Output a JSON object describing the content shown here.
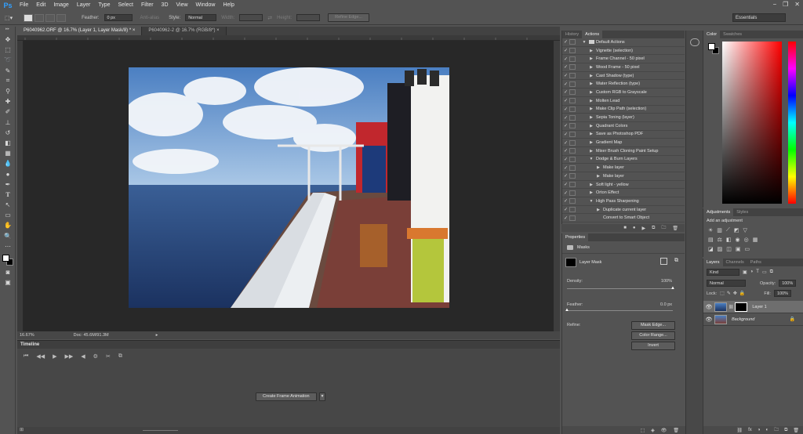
{
  "app": {
    "logo": "Ps"
  },
  "menu": [
    "File",
    "Edit",
    "Image",
    "Layer",
    "Type",
    "Select",
    "Filter",
    "3D",
    "View",
    "Window",
    "Help"
  ],
  "window_controls": [
    "−",
    "❐",
    "✕"
  ],
  "options": {
    "feather_label": "Feather:",
    "feather_value": "0 px",
    "antialias_label": "Anti-alias",
    "style_label": "Style:",
    "style_value": "Normal",
    "width_label": "Width:",
    "height_label": "Height:",
    "refine_edge": "Refine Edge...",
    "workspace": "Essentials"
  },
  "tabs": [
    {
      "label": "P6040962.ORF @ 16.7% (Layer 1, Layer Mask/8) *",
      "close": "×"
    },
    {
      "label": "P6040962-2 @ 16.7% (RGB/8*)",
      "close": "×"
    }
  ],
  "status": {
    "zoom": "16.67%",
    "doc": "Doc: 45.6M/91.3M"
  },
  "timeline": {
    "title": "Timeline",
    "create_button": "Create Frame Animation",
    "controls": [
      "⏮",
      "◀◀",
      "▶",
      "▶▶",
      "◀",
      "⚙",
      "✂",
      "⧉"
    ],
    "footer": "⊞"
  },
  "actions_panel": {
    "tabs": [
      "History",
      "Actions"
    ],
    "rows": [
      {
        "label": "Default Actions",
        "indent": 0,
        "tri": "▼",
        "folder": true
      },
      {
        "label": "Vignette (selection)",
        "indent": 1,
        "tri": "▶"
      },
      {
        "label": "Frame Channel - 50 pixel",
        "indent": 1,
        "tri": "▶"
      },
      {
        "label": "Wood Frame - 50 pixel",
        "indent": 1,
        "tri": "▶"
      },
      {
        "label": "Cast Shadow (type)",
        "indent": 1,
        "tri": "▶"
      },
      {
        "label": "Water Reflection (type)",
        "indent": 1,
        "tri": "▶"
      },
      {
        "label": "Custom RGB to Grayscale",
        "indent": 1,
        "tri": "▶"
      },
      {
        "label": "Molten Lead",
        "indent": 1,
        "tri": "▶"
      },
      {
        "label": "Make Clip Path (selection)",
        "indent": 1,
        "tri": "▶"
      },
      {
        "label": "Sepia Toning (layer)",
        "indent": 1,
        "tri": "▶"
      },
      {
        "label": "Quadrant Colors",
        "indent": 1,
        "tri": "▶"
      },
      {
        "label": "Save as Photoshop PDF",
        "indent": 1,
        "tri": "▶"
      },
      {
        "label": "Gradient Map",
        "indent": 1,
        "tri": "▶"
      },
      {
        "label": "Mixer Brush Cloning Paint Setup",
        "indent": 1,
        "tri": "▶"
      },
      {
        "label": "Dodge & Burn Layers",
        "indent": 1,
        "tri": "▼"
      },
      {
        "label": "Make layer",
        "indent": 2,
        "tri": "▶"
      },
      {
        "label": "Make layer",
        "indent": 2,
        "tri": "▶"
      },
      {
        "label": "Soft light - yellow",
        "indent": 1,
        "tri": "▶"
      },
      {
        "label": "Orton Effect",
        "indent": 1,
        "tri": "▶"
      },
      {
        "label": "High Pass Sharpening",
        "indent": 1,
        "tri": "▼"
      },
      {
        "label": "Duplicate current layer",
        "indent": 2,
        "tri": "▶"
      },
      {
        "label": "Convert to Smart Object",
        "indent": 2,
        "tri": ""
      }
    ],
    "footer_icons": [
      "■",
      "●",
      "▶",
      "⧉",
      "🗀",
      "🗑"
    ]
  },
  "properties": {
    "title": "Properties",
    "section": "Masks",
    "mask_label": "Layer Mask",
    "density_label": "Density:",
    "density_value": "100%",
    "density": 1.0,
    "feather_label": "Feather:",
    "feather_value": "0.0 px",
    "feather": 0.0,
    "refine_label": "Refine:",
    "mask_edge": "Mask Edge...",
    "color_range": "Color Range...",
    "invert": "Invert"
  },
  "color_panel": {
    "tabs": [
      "Color",
      "Swatches"
    ]
  },
  "adjustments": {
    "tabs": [
      "Adjustments",
      "Styles"
    ],
    "subtitle": "Add an adjustment"
  },
  "layers_panel": {
    "tabs": [
      "Layers",
      "Channels",
      "Paths"
    ],
    "filter": "Kind",
    "blend": "Normal",
    "opacity_label": "Opacity:",
    "opacity": "100%",
    "lock_label": "Lock:",
    "fill_label": "Fill:",
    "fill": "100%",
    "layers": [
      {
        "name": "Layer 1",
        "selected": true,
        "has_mask": true
      },
      {
        "name": "Background",
        "selected": false,
        "locked": true
      }
    ],
    "footer_icons": [
      "⛓",
      "fx",
      "◑",
      "◐",
      "🗀",
      "⧉",
      "🗑"
    ]
  }
}
